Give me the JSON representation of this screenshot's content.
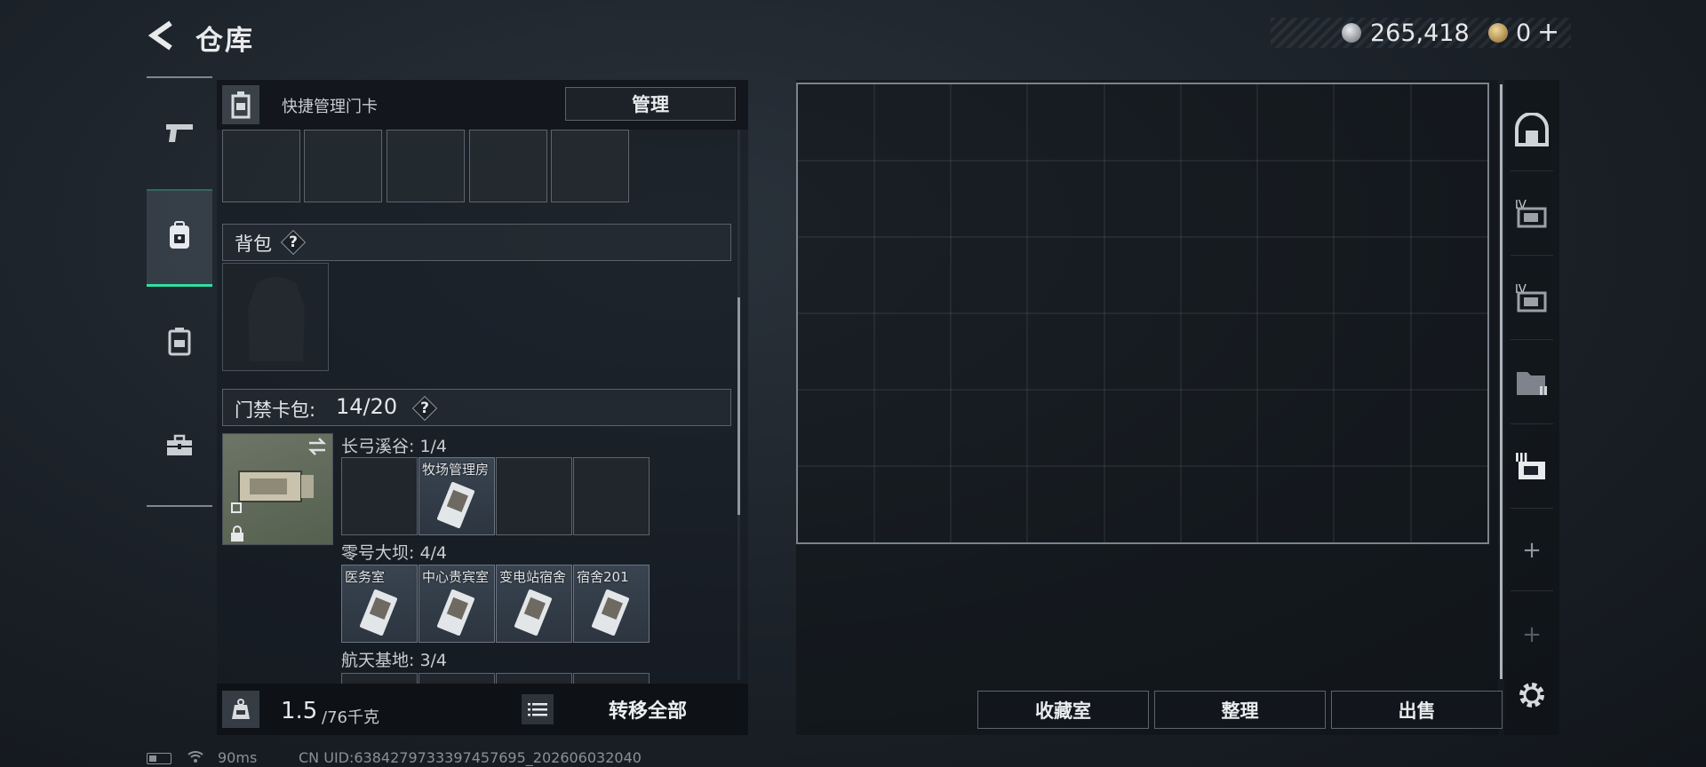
{
  "header": {
    "title": "仓库",
    "currency_silver": "265,418",
    "currency_gold": "0",
    "currency_add": "+"
  },
  "left_panel": {
    "quick_manage_label": "快捷管理门卡",
    "manage_button": "管理",
    "backpack_section": {
      "title": "背包",
      "help": "?"
    },
    "cardpack_section": {
      "title": "门禁卡包:",
      "count": "14/20",
      "help": "?"
    },
    "regions": [
      {
        "label": "长弓溪谷: 1/4",
        "cards": [
          "",
          "牧场管理房",
          "",
          ""
        ]
      },
      {
        "label": "零号大坝: 4/4",
        "cards": [
          "医务室",
          "中心贵宾室",
          "变电站宿舍",
          "宿舍201"
        ]
      },
      {
        "label": "航天基地: 3/4",
        "cards": []
      }
    ],
    "weight_current": "1.5",
    "weight_max": "/76千克",
    "transfer_all_button": "转移全部"
  },
  "storage": {
    "columns": 9,
    "rows": 6,
    "buttons": {
      "collection": "收藏室",
      "sort": "整理",
      "sell": "出售"
    }
  },
  "status_bar": {
    "ping": "90ms",
    "uid": "CN UID:638427973339745769​5_202606032040"
  },
  "icons": {
    "back": "back-arrow-icon",
    "rail": [
      "pistol-icon",
      "backpack-lock-icon",
      "backpack-icon",
      "toolbox-icon"
    ],
    "right_rail": [
      "vault-icon",
      "card-iv-icon",
      "card-iv-icon",
      "folder-icon",
      "card-iii-icon",
      "plus-icon",
      "plus-icon",
      "gear-icon"
    ]
  },
  "colors": {
    "accent_green": "#2fe0a4",
    "panel_bg": "#1b2128"
  }
}
